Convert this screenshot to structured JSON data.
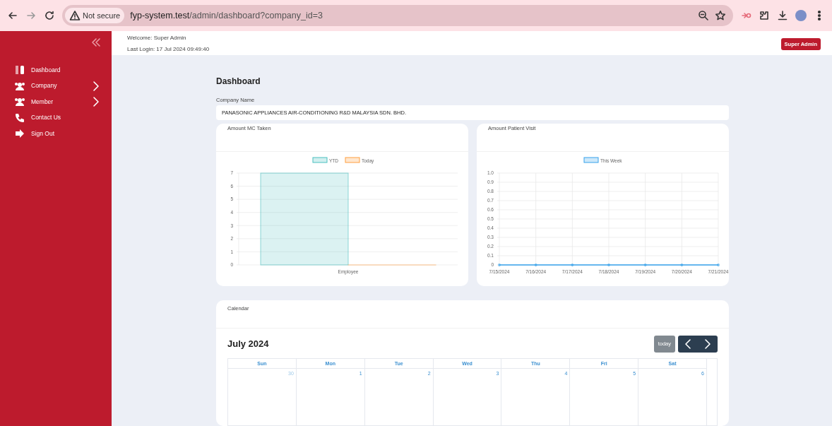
{
  "browser": {
    "security": "Not secure",
    "url_host": "fyp-system.test",
    "url_path": "/admin/dashboard?company_id=3"
  },
  "sidebar": {
    "items": [
      {
        "label": "Dashboard",
        "submenu": false
      },
      {
        "label": "Company",
        "submenu": true
      },
      {
        "label": "Member",
        "submenu": true
      },
      {
        "label": "Contact Us",
        "submenu": false
      },
      {
        "label": "Sign Out",
        "submenu": false
      }
    ]
  },
  "header": {
    "welcome": "Welcome: Super Admin",
    "last_login": "Last Login: 17 Jul 2024 09:49:40",
    "role_badge": "Super Admin"
  },
  "page_title": "Dashboard",
  "company": {
    "label": "Company Name",
    "value": "PANASONIC APPLIANCES AIR-CONDITIONING R&D MALAYSIA SDN. BHD."
  },
  "charts": [
    {
      "title": "Amount MC Taken",
      "chart_data": {
        "type": "bar",
        "categories": [
          "Employee"
        ],
        "series": [
          {
            "name": "YTD",
            "color": "#4bc0c0",
            "values": [
              7
            ]
          },
          {
            "name": "Today",
            "color": "#ff9f40",
            "values": [
              0
            ]
          }
        ],
        "ylim": [
          0,
          7
        ],
        "yticks": [
          0,
          1,
          2,
          3,
          4,
          5,
          6,
          7
        ],
        "grid": true,
        "legend": "top"
      }
    },
    {
      "title": "Amount Patient Visit",
      "chart_data": {
        "type": "line",
        "categories": [
          "7/15/2024",
          "7/16/2024",
          "7/17/2024",
          "7/18/2024",
          "7/19/2024",
          "7/20/2024",
          "7/21/2024"
        ],
        "series": [
          {
            "name": "This Week",
            "color": "#36a2eb",
            "values": [
              0,
              0,
              0,
              0,
              0,
              0,
              0
            ]
          }
        ],
        "ylim": [
          0,
          1
        ],
        "yticks": [
          0,
          {
            "value": 0.1,
            "label": "0.1"
          },
          {
            "value": 0.2,
            "label": "0.2"
          },
          {
            "value": 0.3,
            "label": "0.3"
          },
          {
            "value": 0.4,
            "label": "0.4"
          },
          {
            "value": 0.5,
            "label": "0.5"
          },
          {
            "value": 0.6,
            "label": "0.6"
          },
          {
            "value": 0.7,
            "label": "0.7"
          },
          {
            "value": 0.8,
            "label": "0.8"
          },
          {
            "value": 0.9,
            "label": "0.9"
          },
          {
            "value": 1,
            "label": "1.0"
          }
        ],
        "grid": true,
        "legend": "top"
      }
    }
  ],
  "calendar": {
    "card_title": "Calendar",
    "month": "July 2024",
    "today_button": "today",
    "today_disabled": true,
    "weekdays": [
      "Sun",
      "Mon",
      "Tue",
      "Wed",
      "Thu",
      "Fri",
      "Sat"
    ],
    "days": [
      {
        "day": "30",
        "other_month": true
      },
      {
        "day": "1",
        "other_month": false
      },
      {
        "day": "2",
        "other_month": false
      },
      {
        "day": "3",
        "other_month": false
      },
      {
        "day": "4",
        "other_month": false
      },
      {
        "day": "5",
        "other_month": false
      },
      {
        "day": "6",
        "other_month": false
      }
    ]
  }
}
